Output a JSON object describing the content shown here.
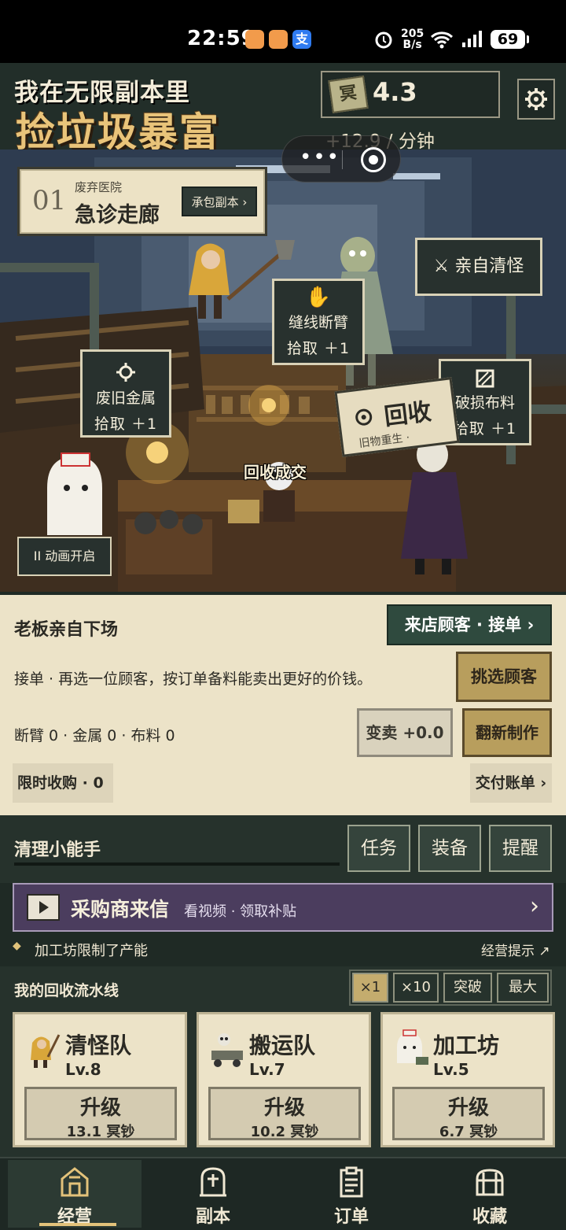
{
  "status_bar": {
    "time": "22:59",
    "net_speed_top": "205",
    "net_speed_unit": "B/s",
    "signal_label": "5G",
    "wifi_label": "6",
    "battery": "69"
  },
  "header": {
    "title_line1": "我在无限副本里",
    "title_line2": "捡垃圾暴富",
    "currency_icon_text": "冥",
    "currency_value": "4.3",
    "rate": "+12.9 / 分钟"
  },
  "scene": {
    "dungeon_number": "01",
    "dungeon_area": "废弃医院",
    "dungeon_room": "急诊走廊",
    "contract_button": "承包副本 ›",
    "clear_button": "⚔ 亲自清怪",
    "loot": [
      {
        "name": "缝线断臂",
        "action": "拾取 ＋1"
      },
      {
        "name": "废旧金属",
        "action": "拾取 ＋1"
      },
      {
        "name": "破损布料",
        "action": "拾取 ＋1"
      }
    ],
    "recycle_sign_title": "回收",
    "recycle_sign_sub": "旧物重生 ·",
    "floating_text": "回收成交",
    "animation_toggle": "II 动画开启"
  },
  "boss": {
    "title": "老板亲自下场",
    "customer_button": "来店顾客 · 接单 ›",
    "description": "接单 · 再选一位顾客，按订单备料能卖出更好的价钱。",
    "pick_customer": "挑选顾客",
    "inventory": "断臂 0 · 金属 0 · 布料 0",
    "sell_button": "变卖 +0.0",
    "refurbish_button": "翻新制作",
    "limited_buy": "限时收购 · 0",
    "deliver_bill": "交付账单 ›"
  },
  "cleaner": {
    "title": "清理小能手",
    "tabs": [
      "任务",
      "装备",
      "提醒"
    ]
  },
  "ad": {
    "title": "采购商来信",
    "subtitle": "看视频 · 领取补贴",
    "arrow": "›"
  },
  "notice": {
    "text": "加工坊限制了产能",
    "tip": "经营提示 ↗"
  },
  "pipeline": {
    "title": "我的回收流水线",
    "multipliers": [
      "×1",
      "×10",
      "突破",
      "最大"
    ],
    "selected_multiplier": "×1",
    "cards": [
      {
        "name": "清怪队",
        "level": "Lv.8",
        "upgrade": "升级",
        "cost": "13.1 冥钞"
      },
      {
        "name": "搬运队",
        "level": "Lv.7",
        "upgrade": "升级",
        "cost": "10.2 冥钞"
      },
      {
        "name": "加工坊",
        "level": "Lv.5",
        "upgrade": "升级",
        "cost": "6.7 冥钞"
      }
    ]
  },
  "nav": {
    "items": [
      "经营",
      "副本",
      "订单",
      "收藏"
    ],
    "active": "经营"
  },
  "colors": {
    "accent_gold": "#e9c47a",
    "panel_cream": "#ece3c8",
    "dark_green": "#2f4a3e",
    "ad_purple": "#4b3d5e"
  }
}
